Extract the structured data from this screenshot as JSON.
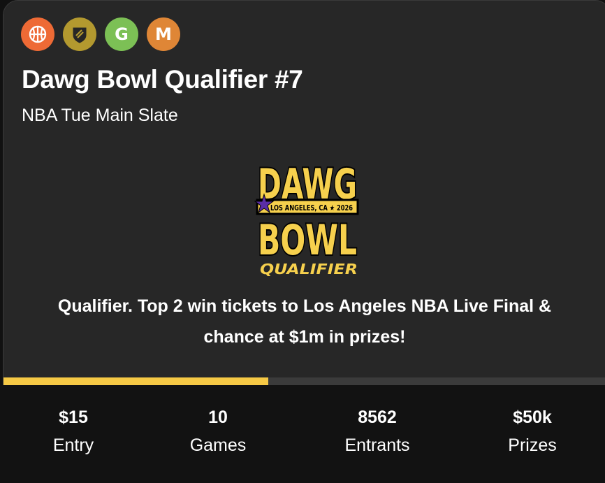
{
  "contest": {
    "title": "Dawg Bowl Qualifier #7",
    "subtitle": "NBA Tue Main Slate",
    "description_line1": "Qualifier. Top 2 win tickets to Los Angeles NBA Live Final &",
    "description_line2": "chance at $1m in prizes!",
    "progress_fraction": 0.44
  },
  "badges": [
    {
      "icon": "basketball-icon",
      "color": "#ee6a35"
    },
    {
      "icon": "shield-icon",
      "color": "#b3992f"
    },
    {
      "letter": "G",
      "color": "#7cc055"
    },
    {
      "letter": "M",
      "color": "#df8636"
    }
  ],
  "logo": {
    "line1": "DAWG",
    "ribbon": "LOS ANGELES, CA ★ 2026",
    "line2": "BOWL",
    "tag": "QUALIFIER",
    "yellow": "#f6d04d",
    "purple": "#5a2ea6"
  },
  "stats": [
    {
      "value": "$15",
      "label": "Entry"
    },
    {
      "value": "10",
      "label": "Games"
    },
    {
      "value": "8562",
      "label": "Entrants"
    },
    {
      "value": "$50k",
      "label": "Prizes"
    }
  ]
}
